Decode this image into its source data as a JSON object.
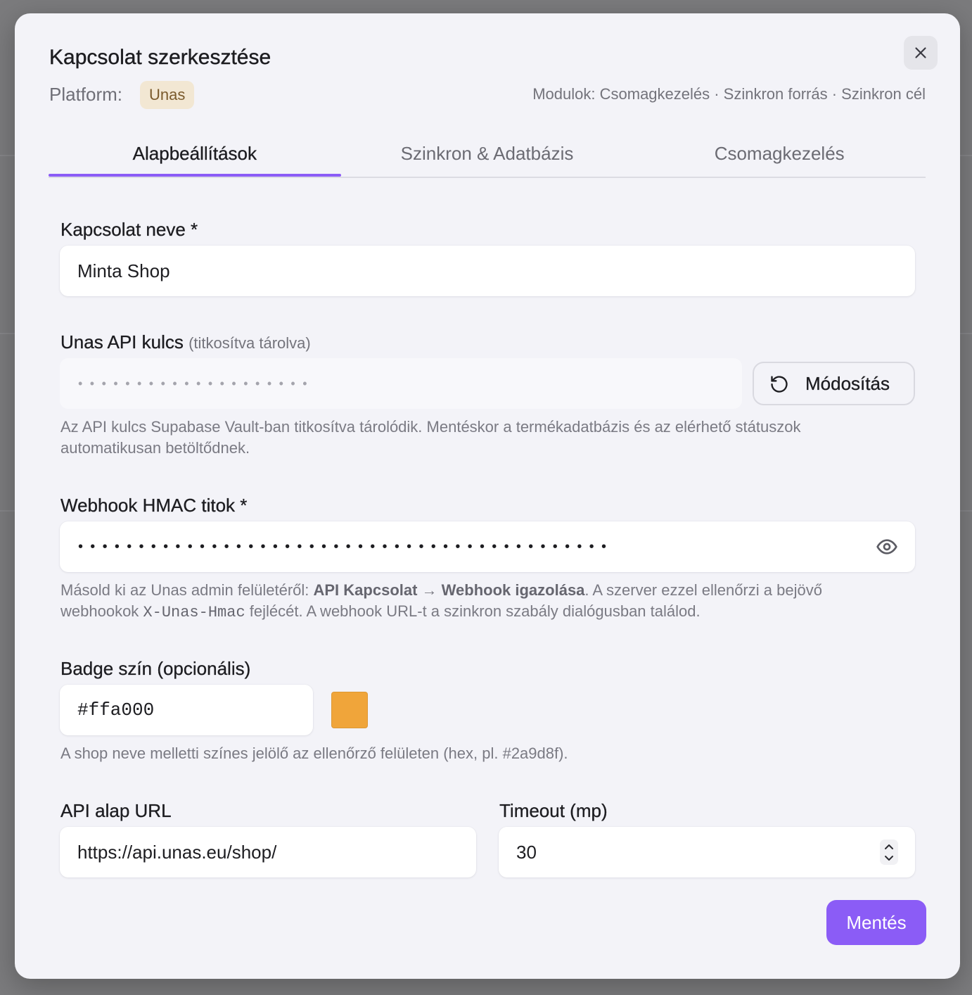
{
  "dialog": {
    "title": "Kapcsolat szerkesztése",
    "platform_label": "Platform:",
    "platform_badge": "Unas",
    "modules_text": "Modulok: Csomagkezelés · Szinkron forrás · Szinkron cél",
    "close_icon": "close-icon"
  },
  "tabs": [
    {
      "label": "Alapbeállítások",
      "active": true
    },
    {
      "label": "Szinkron & Adatbázis",
      "active": false
    },
    {
      "label": "Csomagkezelés",
      "active": false
    }
  ],
  "form": {
    "connection_name": {
      "label": "Kapcsolat neve *",
      "value": "Minta Shop"
    },
    "api_key": {
      "label": "Unas API kulcs",
      "label_note": "(titkosítva tárolva)",
      "masked_value": "••••••••••••••••••••",
      "edit_button": "Módosítás",
      "edit_icon": "refresh-icon",
      "help": "Az API kulcs Supabase Vault-ban titkosítva tárolódik. Mentéskor a termékadatbázis és az elérhető státuszok automatikusan betöltődnek."
    },
    "hmac_secret": {
      "label": "Webhook HMAC titok *",
      "masked_value": "••••••••••••••••••••••••••••••••••••••••••••",
      "toggle_icon": "eye-icon",
      "help": {
        "prefix": "Másold ki az Unas admin felületéről: ",
        "bold_1": "API Kapcsolat",
        "arrow": " → ",
        "bold_2": "Webhook igazolása",
        "middle": ". A szerver ezzel ellenőrzi a bejövő webhookok ",
        "code": "X-Unas-Hmac",
        "suffix": " fejlécét. A webhook URL-t a szinkron szabály dialógusban találod."
      }
    },
    "badge_color": {
      "label": "Badge szín (opcionális)",
      "value": "#ffa000",
      "swatch_color": "#f0a53a",
      "help": "A shop neve melletti színes jelölő az ellenőrző felületen (hex, pl. #2a9d8f)."
    },
    "api_base_url": {
      "label": "API alap URL",
      "value": "https://api.unas.eu/shop/"
    },
    "timeout": {
      "label": "Timeout (mp)",
      "value": "30",
      "spinner_icon": "number-stepper-icon"
    }
  },
  "actions": {
    "save_label": "Mentés"
  },
  "colors": {
    "accent": "#8b5cf6",
    "badge_background": "#f2e7d3",
    "badge_text": "#7a5a2c"
  }
}
